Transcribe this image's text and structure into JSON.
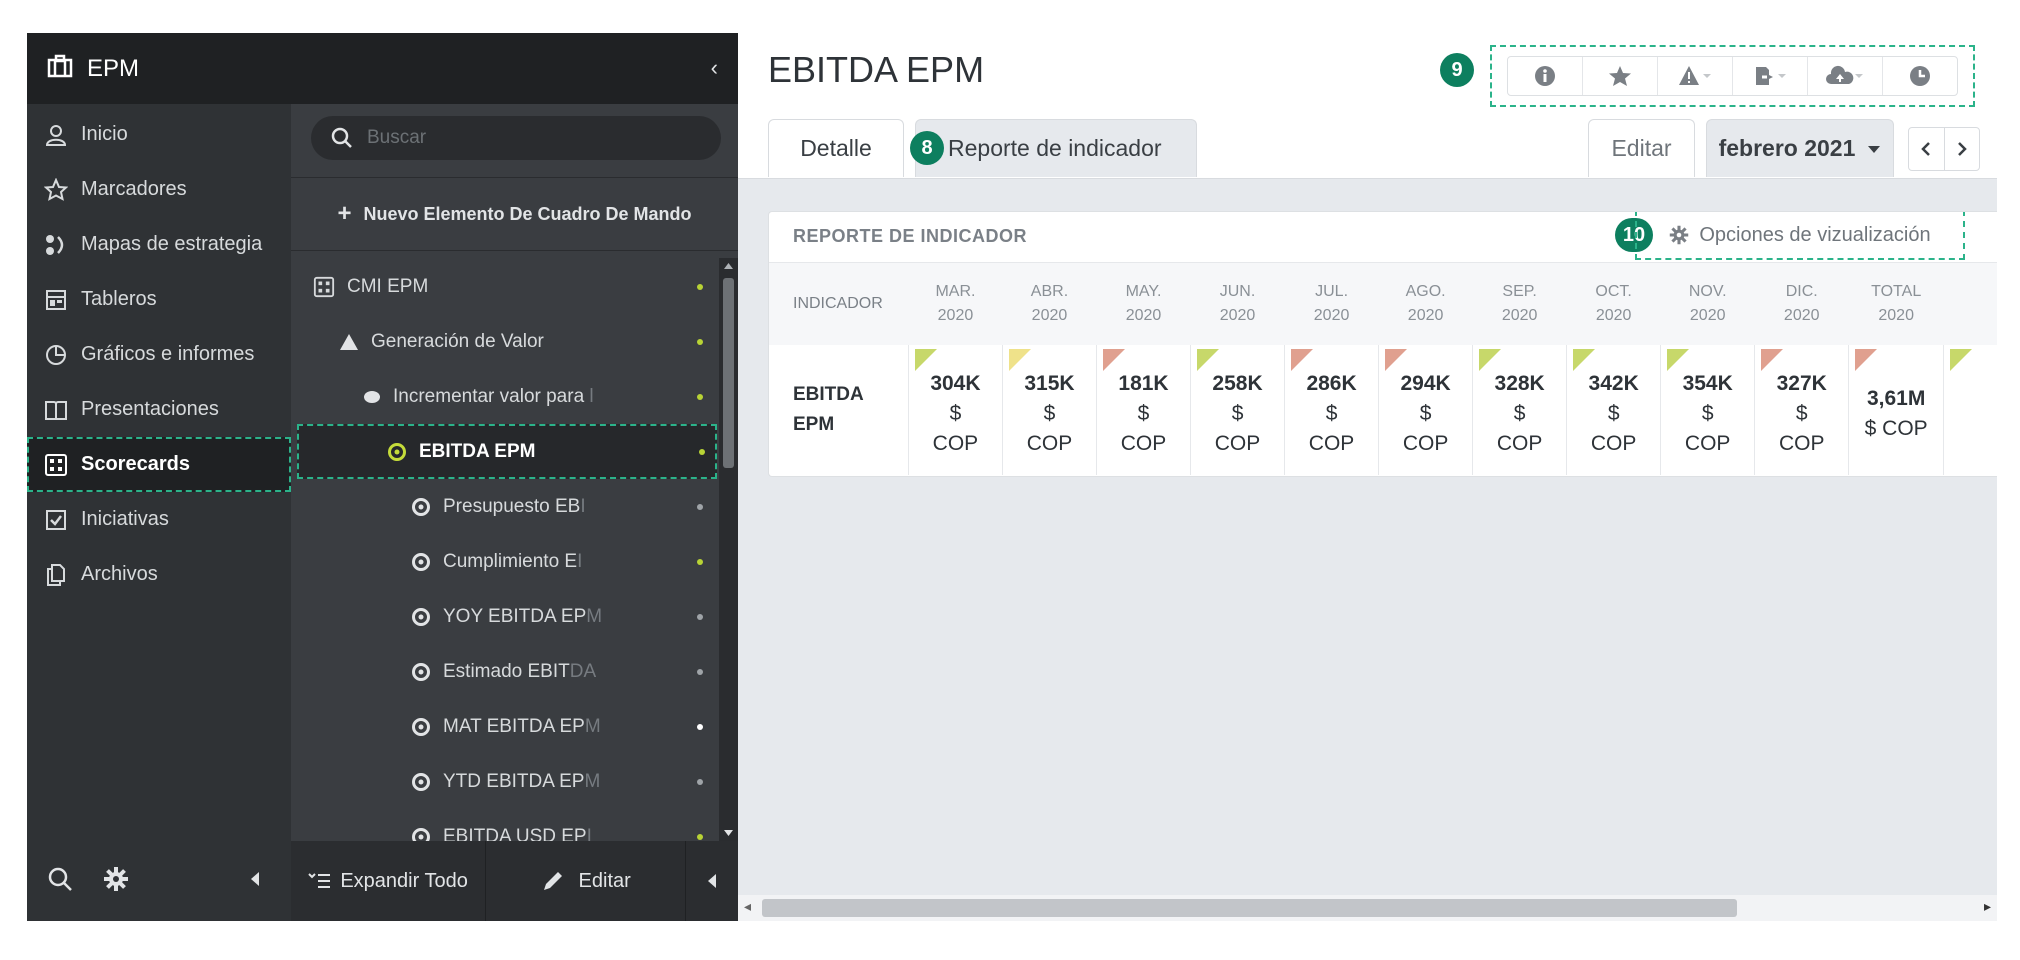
{
  "nav": {
    "title": "EPM",
    "items": [
      {
        "label": "Inicio",
        "icon": "user-icon"
      },
      {
        "label": "Marcadores",
        "icon": "star-icon"
      },
      {
        "label": "Mapas de estrategia",
        "icon": "strategy-map-icon"
      },
      {
        "label": "Tableros",
        "icon": "dashboard-icon"
      },
      {
        "label": "Gráficos e informes",
        "icon": "pie-chart-icon"
      },
      {
        "label": "Presentaciones",
        "icon": "book-icon"
      },
      {
        "label": "Scorecards",
        "icon": "scorecard-icon"
      },
      {
        "label": "Iniciativas",
        "icon": "checkbox-icon"
      },
      {
        "label": "Archivos",
        "icon": "files-icon"
      }
    ],
    "active_index": 6
  },
  "tree": {
    "collapse_symbol": "‹",
    "search_placeholder": "Buscar",
    "new_element": "Nuevo Elemento De Cuadro De Mando",
    "items": [
      {
        "label": "CMI EPM",
        "fade": "",
        "icon": "scorecard-icon",
        "dot": "#b8d335"
      },
      {
        "label": "Generación de Valor",
        "fade": "",
        "icon": "triangle-icon",
        "dot": "#b8d335"
      },
      {
        "label": "Incrementar valor para ",
        "fade": "l",
        "icon": "ellipse-icon",
        "dot": "#b8d335"
      },
      {
        "label": "EBITDA EPM",
        "fade": "",
        "icon": "target-icon",
        "dot": "#b8d335"
      },
      {
        "label": "Presupuesto EB",
        "fade": "I",
        "icon": "target-icon",
        "dot": "#9fa4a8"
      },
      {
        "label": "Cumplimiento E",
        "fade": "I",
        "icon": "target-icon",
        "dot": "#b8d335"
      },
      {
        "label": "YOY EBITDA EP",
        "fade": "M",
        "icon": "target-icon",
        "dot": "#9fa4a8"
      },
      {
        "label": "Estimado EBIT",
        "fade": "DA",
        "icon": "target-icon",
        "dot": "#9fa4a8"
      },
      {
        "label": "MAT EBITDA EP",
        "fade": "M",
        "icon": "target-icon",
        "dot": "#ffffff"
      },
      {
        "label": "YTD EBITDA EP",
        "fade": "M",
        "icon": "target-icon",
        "dot": "#9fa4a8"
      },
      {
        "label": "EBITDA USD EP",
        "fade": "I",
        "icon": "target-icon",
        "dot": "#b8d335"
      }
    ],
    "footer": {
      "expand": "Expandir Todo",
      "edit": "Editar"
    }
  },
  "main": {
    "title": "EBITDA EPM",
    "tabs": {
      "detail": "Detalle",
      "report": "Reporte de indicador",
      "edit": "Editar",
      "period": "febrero 2021"
    },
    "badges": {
      "report": "8",
      "toolbar": "9",
      "options": "10"
    },
    "toolbar_icons": [
      "info-icon",
      "star-icon",
      "warning-icon",
      "export-icon",
      "cloud-upload-icon",
      "clock-icon"
    ]
  },
  "report": {
    "title": "REPORTE DE INDICADOR",
    "options": "Opciones de vizualización",
    "indicator_header": "INDICADOR",
    "indicator": "EBITDA EPM",
    "columns": [
      {
        "month": "MAR.",
        "year": "2020",
        "value": "304K",
        "cur1": "$",
        "cur2": "COP",
        "flag": "#c7d86a"
      },
      {
        "month": "ABR.",
        "year": "2020",
        "value": "315K",
        "cur1": "$",
        "cur2": "COP",
        "flag": "#efe28a"
      },
      {
        "month": "MAY.",
        "year": "2020",
        "value": "181K",
        "cur1": "$",
        "cur2": "COP",
        "flag": "#e0a08f"
      },
      {
        "month": "JUN.",
        "year": "2020",
        "value": "258K",
        "cur1": "$",
        "cur2": "COP",
        "flag": "#c7d86a"
      },
      {
        "month": "JUL.",
        "year": "2020",
        "value": "286K",
        "cur1": "$",
        "cur2": "COP",
        "flag": "#e0a08f"
      },
      {
        "month": "AGO.",
        "year": "2020",
        "value": "294K",
        "cur1": "$",
        "cur2": "COP",
        "flag": "#e0a08f"
      },
      {
        "month": "SEP.",
        "year": "2020",
        "value": "328K",
        "cur1": "$",
        "cur2": "COP",
        "flag": "#c7d86a"
      },
      {
        "month": "OCT.",
        "year": "2020",
        "value": "342K",
        "cur1": "$",
        "cur2": "COP",
        "flag": "#c7d86a"
      },
      {
        "month": "NOV.",
        "year": "2020",
        "value": "354K",
        "cur1": "$",
        "cur2": "COP",
        "flag": "#c7d86a"
      },
      {
        "month": "DIC.",
        "year": "2020",
        "value": "327K",
        "cur1": "$",
        "cur2": "COP",
        "flag": "#e0a08f"
      },
      {
        "month": "TOTAL",
        "year": "2020",
        "value": "3,61M",
        "cur1": "$ COP",
        "cur2": "",
        "flag": "#e0a08f"
      }
    ]
  },
  "colors": {
    "accent": "#2bb38a",
    "badge": "#0d7f5f",
    "sidebar": "#2f3235",
    "tree": "#3a3d41"
  }
}
